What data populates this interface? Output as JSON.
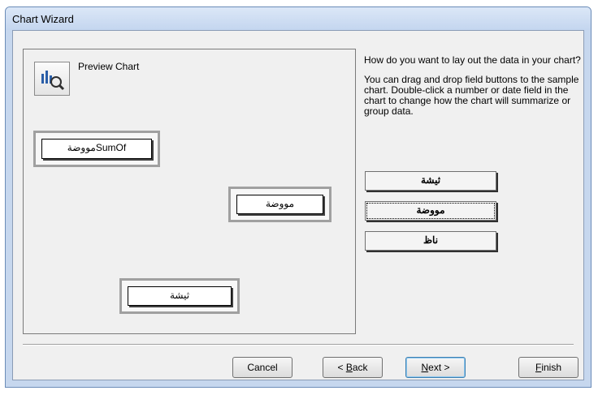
{
  "window": {
    "title": "Chart Wizard"
  },
  "preview": {
    "label": "Preview Chart",
    "icon": "chart-magnifier-icon"
  },
  "chart_zones": {
    "data_field": "مووضةSumOf",
    "series_field": "مووضة",
    "axis_field": "ثيشة"
  },
  "instructions": {
    "question": "How do you want to lay out the data in your chart?",
    "help": "You can drag and drop field buttons to the sample chart. Double-click a number or date field in the chart to change how the chart will summarize or group data."
  },
  "fields": [
    {
      "label": "ثيشة"
    },
    {
      "label": "مووضة"
    },
    {
      "label": "ناظ"
    }
  ],
  "buttons": {
    "cancel": "Cancel",
    "back_prefix": "< ",
    "back_key": "B",
    "back_rest": "ack",
    "next_key": "N",
    "next_rest": "ext >",
    "finish_key": "F",
    "finish_rest": "inish"
  }
}
